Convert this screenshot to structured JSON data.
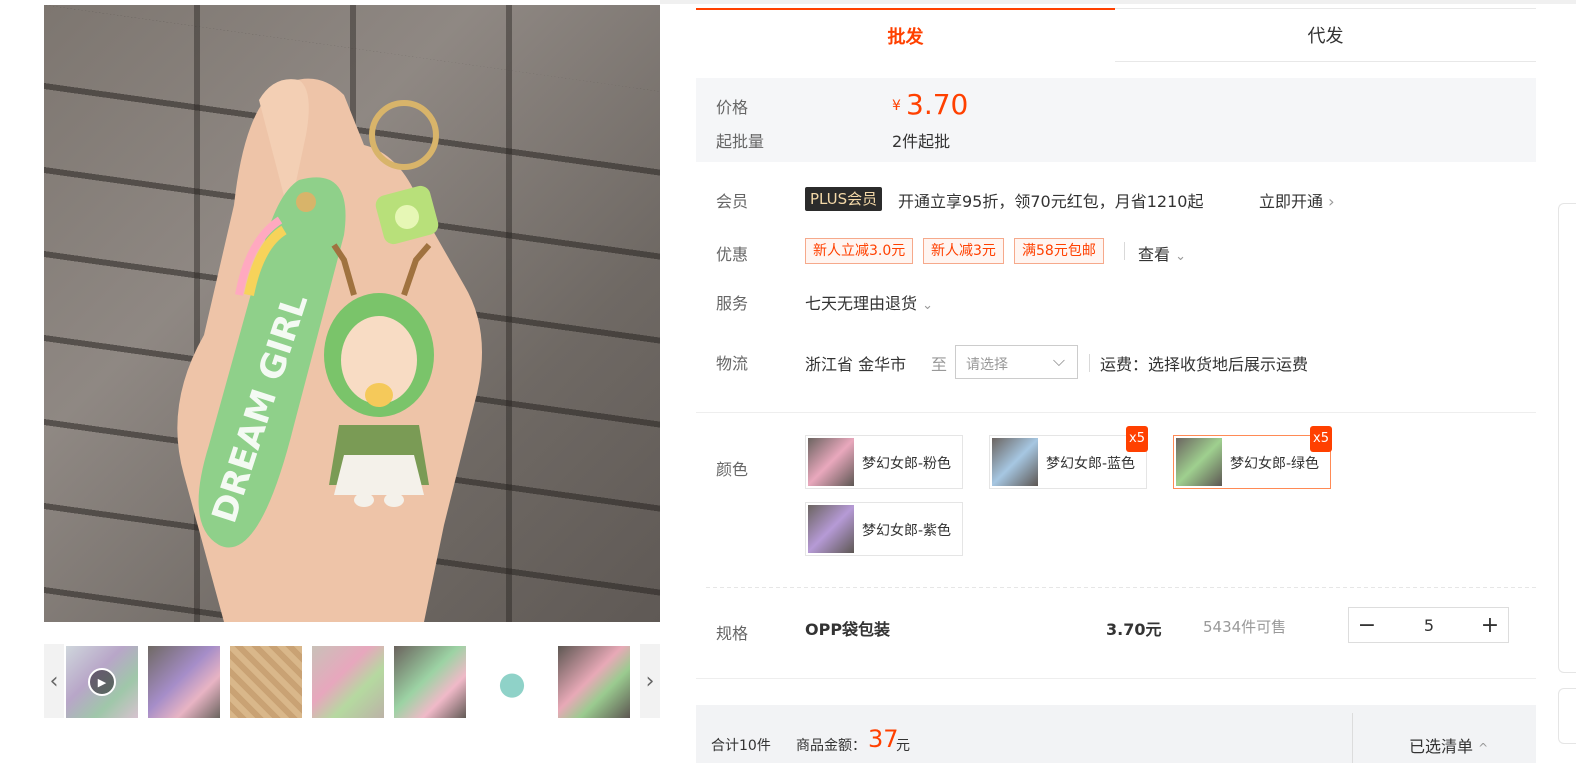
{
  "tabs": [
    {
      "label": "批发",
      "active": true
    },
    {
      "label": "代发",
      "active": false
    }
  ],
  "price": {
    "price_label": "价格",
    "currency": "¥",
    "value": "3.70",
    "moq_label": "起批量",
    "moq_value": "2件起批"
  },
  "member": {
    "label": "会员",
    "badge": "PLUS会员",
    "text": "开通立享95折，领70元红包，月省1210起",
    "action": "立即开通",
    "action_icon": "chevron-right-icon"
  },
  "discount": {
    "label": "优惠",
    "coupons": [
      "新人立减3.0元",
      "新人减3元",
      "满58元包邮"
    ],
    "view_more": "查看",
    "view_icon": "chevron-down-icon"
  },
  "service": {
    "label": "服务",
    "value": "七天无理由退货",
    "icon": "chevron-down-icon"
  },
  "logistics": {
    "label": "物流",
    "origin": "浙江省 金华市",
    "to": "至",
    "select_placeholder": "请选择",
    "freight": "运费：选择收货地后展示运费"
  },
  "color": {
    "label": "颜色",
    "options": [
      {
        "name": "梦幻女郎-粉色",
        "selected": false,
        "qty": ""
      },
      {
        "name": "梦幻女郎-蓝色",
        "selected": false,
        "qty": "x5"
      },
      {
        "name": "梦幻女郎-绿色",
        "selected": true,
        "qty": "x5"
      },
      {
        "name": "梦幻女郎-紫色",
        "selected": false,
        "qty": ""
      }
    ]
  },
  "spec": {
    "label": "规格",
    "name": "OPP袋包装",
    "price": "3.70元",
    "stock": "5434件可售",
    "quantity": "5"
  },
  "summary": {
    "count": "合计10件",
    "amount_label": "商品金额：",
    "amount": "37",
    "unit": "元",
    "selected_list": "已选清单",
    "list_icon": "chevron-up-icon"
  },
  "gallery": {
    "thumb_count": 7,
    "has_video": true
  },
  "colors": {
    "accent": "#ff4000",
    "price_bg": "#f5f6f8",
    "coupon_border": "#f6a98b",
    "plus_bg": "#2b2b2b",
    "plus_text": "#f3d8a8"
  }
}
